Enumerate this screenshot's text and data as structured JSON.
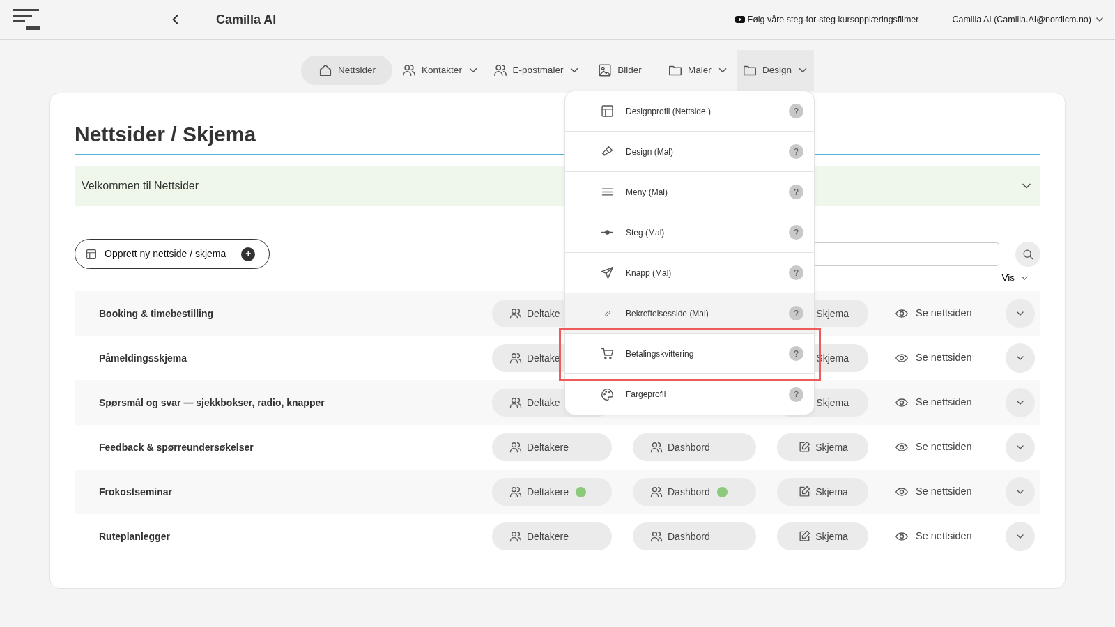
{
  "header": {
    "title": "Camilla AI",
    "video_link": "Følg våre steg-for-steg kursopplæringsfilmer",
    "user": "Camilla AI (Camilla.AI@nordicm.no)"
  },
  "nav": [
    {
      "label": "Nettsider",
      "selected": true,
      "open": false,
      "has_menu": false
    },
    {
      "label": "Kontakter",
      "selected": false,
      "open": false,
      "has_menu": true
    },
    {
      "label": "E-postmaler",
      "selected": false,
      "open": false,
      "has_menu": true
    },
    {
      "label": "Bilder",
      "selected": false,
      "open": false,
      "has_menu": false
    },
    {
      "label": "Maler",
      "selected": false,
      "open": false,
      "has_menu": true
    },
    {
      "label": "Design",
      "selected": false,
      "open": true,
      "has_menu": true
    }
  ],
  "design_menu": [
    {
      "label": "Designprofil (Nettside )",
      "help": "?",
      "highlighted": false,
      "framed": false
    },
    {
      "label": "Design (Mal)",
      "help": "?",
      "highlighted": false,
      "framed": false
    },
    {
      "label": "Meny (Mal)",
      "help": "?",
      "highlighted": false,
      "framed": false
    },
    {
      "label": "Steg (Mal)",
      "help": "?",
      "highlighted": false,
      "framed": false
    },
    {
      "label": "Knapp (Mal)",
      "help": "?",
      "highlighted": false,
      "framed": false
    },
    {
      "label": "Bekreftelsesside (Mal)",
      "help": "?",
      "highlighted": true,
      "framed": false
    },
    {
      "label": "Betalingskvittering",
      "help": "?",
      "highlighted": false,
      "framed": true
    },
    {
      "label": "Fargeprofil",
      "help": "?",
      "highlighted": false,
      "framed": false
    }
  ],
  "page": {
    "title": "Nettsider / Skjema",
    "welcome": "Velkommen til Nettsider",
    "create_button": "Opprett ny nettside / skjema",
    "create_plus": "+",
    "vis": "Vis"
  },
  "rows": [
    {
      "title": "Booking & timebestilling",
      "participants": {
        "label": "Deltake",
        "dot": false
      },
      "form": "Skjema",
      "view": "Se nettsiden"
    },
    {
      "title": "Påmeldingsskjema",
      "participants": {
        "label": "Deltake",
        "dot": false
      },
      "form": "Skjema",
      "view": "Se nettsiden"
    },
    {
      "title": "Spørsmål og svar — sjekkbokser, radio, knapper",
      "participants": {
        "label": "Deltake",
        "dot": false
      },
      "form": "Skjema",
      "view": "Se nettsiden"
    },
    {
      "title": "Feedback & spørreundersøkelser",
      "participants": {
        "label": "Deltakere",
        "dot": false
      },
      "dashboard": {
        "label": "Dashbord",
        "dot": false
      },
      "form": "Skjema",
      "view": "Se nettsiden"
    },
    {
      "title": "Frokostseminar",
      "participants": {
        "label": "Deltakere",
        "dot": true
      },
      "dashboard": {
        "label": "Dashbord",
        "dot": true
      },
      "form": "Skjema",
      "view": "Se nettsiden"
    },
    {
      "title": "Ruteplanlegger",
      "participants": {
        "label": "Deltakere",
        "dot": false
      },
      "dashboard": {
        "label": "Dashbord",
        "dot": false
      },
      "form": "Skjema",
      "view": "Se nettsiden"
    }
  ]
}
